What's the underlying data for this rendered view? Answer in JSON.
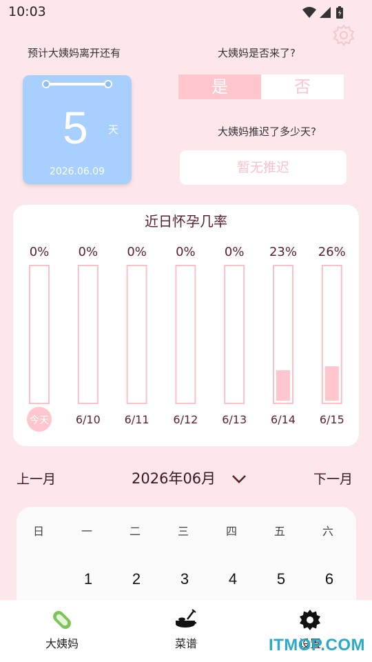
{
  "status": {
    "time": "10:03"
  },
  "summary": {
    "label_left": "预计大姨妈离开还有",
    "days": "5",
    "unit": "天",
    "date": "2026.06.09",
    "came_question": "大姨妈是否来了?",
    "yes": "是",
    "no": "否",
    "delay_question": "大姨妈推迟了多少天?",
    "delay_value": "暂无推迟"
  },
  "chart_data": {
    "type": "bar",
    "title": "近日怀孕几率",
    "categories": [
      "今天",
      "6/10",
      "6/11",
      "6/12",
      "6/13",
      "6/14",
      "6/15"
    ],
    "values": [
      0,
      0,
      0,
      0,
      0,
      23,
      26
    ],
    "value_labels": [
      "0%",
      "0%",
      "0%",
      "0%",
      "0%",
      "23%",
      "26%"
    ],
    "ylim": [
      0,
      100
    ],
    "highlight_category": "今天",
    "colors": {
      "bar_fill": "#ffc6cd",
      "bar_border": "#f9c0c7",
      "label": "#5a1f2a",
      "today_badge": "#ffc6cd"
    }
  },
  "calendar": {
    "prev": "上一月",
    "next": "下一月",
    "month": "2026年06月",
    "weekdays": [
      "日",
      "一",
      "二",
      "三",
      "四",
      "五",
      "六"
    ],
    "first_row": [
      "",
      "1",
      "2",
      "3",
      "4",
      "5",
      "6"
    ]
  },
  "nav": {
    "items": [
      {
        "label": "大姨妈",
        "icon": "pad-icon"
      },
      {
        "label": "菜谱",
        "icon": "cooking-pot-icon"
      },
      {
        "label": "设置",
        "icon": "gear-icon"
      }
    ]
  },
  "watermark": "ITMOP.COM",
  "colors": {
    "background": "#fde7ea",
    "accent_pink": "#ffc6cd",
    "card_blue": "#a7cfff",
    "watermark": "#2aa9c9"
  }
}
